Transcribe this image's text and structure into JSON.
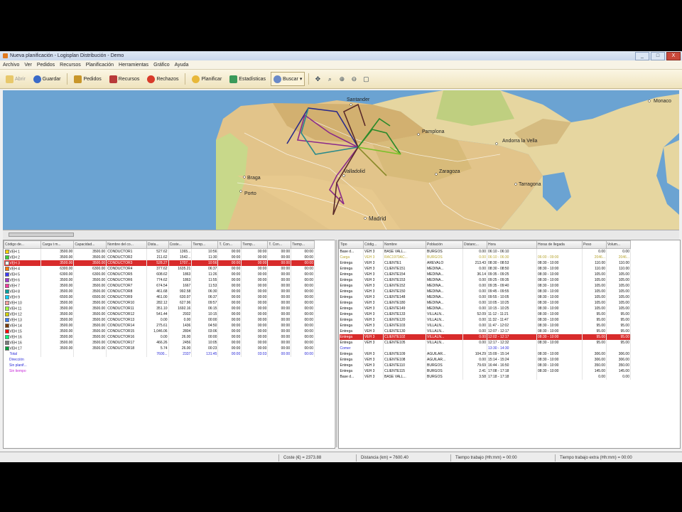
{
  "window": {
    "title": "Nueva planificación - Logisplan Distribución - Demo",
    "min": "_",
    "max": "□",
    "close": "X"
  },
  "menu": [
    "Archivo",
    "Ver",
    "Pedidos",
    "Recursos",
    "Planificación",
    "Herramientas",
    "Gráfico",
    "Ayuda"
  ],
  "toolbar": {
    "abrir": "Abrir",
    "guardar": "Guardar",
    "pedidos": "Pedidos",
    "recursos": "Recursos",
    "rechazos": "Rechazos",
    "planificar": "Planificar",
    "estadisticas": "Estadísticas",
    "buscar": "Buscar"
  },
  "map": {
    "cities": [
      "Santander",
      "Pamplona",
      "Andorra la Vella",
      "Zaragoza",
      "Valladolid",
      "Madrid",
      "Porto",
      "Braga",
      "Monaco",
      "Tarragona"
    ],
    "route_colors": [
      "#2a2a8a",
      "#8a2a8a",
      "#2a8a2a",
      "#8a8a2a",
      "#2a8a8a",
      "#5a2a2a",
      "#7ac02a"
    ]
  },
  "left_table": {
    "headers": [
      "Código de...",
      "Carga t m...",
      "Capacidad...",
      "Nombre del co...",
      "Dista...",
      "Coste...",
      "Tiemp...",
      "T. Con...",
      "Tiemp...",
      "T. Con...",
      "Tiemp..."
    ],
    "rows": [
      {
        "code": "VEH 1",
        "color": "#ffd000",
        "c": [
          "3500.00",
          "3500.00",
          "CONDUCTOR1",
          "527.62",
          "1365...",
          "10:56",
          "00:00",
          "00:00",
          "00:00",
          "00:00"
        ]
      },
      {
        "code": "VEH 2",
        "color": "#3ad03a",
        "c": [
          "3500.00",
          "3500.00",
          "CONDUCTOR2",
          "211.62",
          "1542...",
          "11:30",
          "00:00",
          "00:00",
          "00:00",
          "00:00"
        ]
      },
      {
        "code": "VEH 3",
        "color": "#ffffff",
        "c": [
          "3500.00",
          "3500.00",
          "CONDUCTOR3",
          "528.27",
          "1707...",
          "10:56",
          "00:00",
          "00:00",
          "00:00",
          "00:00"
        ],
        "selected": true
      },
      {
        "code": "VEH 4",
        "color": "#ff7a00",
        "c": [
          "6300.00",
          "6300.00",
          "CONDUCTOR4",
          "377.62",
          "1635.21",
          "06:37",
          "00:00",
          "00:00",
          "00:00",
          "00:00"
        ]
      },
      {
        "code": "VEH 5",
        "color": "#3a3aff",
        "c": [
          "6300.00",
          "6300.00",
          "CONDUCTOR5",
          "608.62",
          "1863",
          "11:26",
          "00:00",
          "00:00",
          "00:00",
          "00:00"
        ]
      },
      {
        "code": "VEH 6",
        "color": "#a03ad0",
        "c": [
          "3500.00",
          "3500.00",
          "CONDUCTOR6",
          "774.62",
          "1863",
          "11:55",
          "00:00",
          "00:00",
          "00:00",
          "00:00"
        ]
      },
      {
        "code": "VEH 7",
        "color": "#ff3aa0",
        "c": [
          "3500.00",
          "3500.00",
          "CONDUCTOR7",
          "674.54",
          "1667",
          "11:53",
          "00:00",
          "00:00",
          "00:00",
          "00:00"
        ]
      },
      {
        "code": "VEH 8",
        "color": "#00a0a0",
        "c": [
          "3500.00",
          "3500.00",
          "CONDUCTOR8",
          "461.68",
          "992.58",
          "06:30",
          "00:00",
          "00:00",
          "00:00",
          "00:00"
        ]
      },
      {
        "code": "VEH 9",
        "color": "#00d0ff",
        "c": [
          "6500.00",
          "6500.00",
          "CONDUCTOR9",
          "461.00",
          "630.97",
          "06:37",
          "00:00",
          "00:00",
          "00:00",
          "00:00"
        ]
      },
      {
        "code": "VEH 10",
        "color": "#ffa0a0",
        "c": [
          "3500.00",
          "3500.00",
          "CONDUCTOR10",
          "282.12",
          "627.96",
          "09:57",
          "00:00",
          "00:00",
          "00:00",
          "00:00"
        ]
      },
      {
        "code": "VEH 11",
        "color": "#a0ff3a",
        "c": [
          "3500.00",
          "3500.00",
          "CONDUCTOR11",
          "351.10",
          "1692.16",
          "06:15",
          "00:00",
          "00:00",
          "00:00",
          "00:00"
        ]
      },
      {
        "code": "VEH 12",
        "color": "#d0d000",
        "c": [
          "3500.00",
          "3500.00",
          "CONDUCTOR12",
          "541.44",
          "2932",
          "10:15",
          "00:00",
          "00:00",
          "00:00",
          "00:00"
        ]
      },
      {
        "code": "VEH 13",
        "color": "#3a7aff",
        "c": [
          "3500.00",
          "3500.00",
          "CONDUCTOR13",
          "0.00",
          "0.00",
          "00:00",
          "00:00",
          "00:00",
          "00:00",
          "00:00"
        ]
      },
      {
        "code": "VEH 14",
        "color": "#7a3a00",
        "c": [
          "3500.00",
          "3500.00",
          "CONDUCTOR14",
          "275.61",
          "1436",
          "04:50",
          "00:00",
          "00:00",
          "00:00",
          "00:00"
        ]
      },
      {
        "code": "VEH 15",
        "color": "#ff0000",
        "c": [
          "3500.00",
          "3500.00",
          "CONDUCTOR15",
          "1,046.06",
          "2804",
          "03:06",
          "00:00",
          "00:00",
          "00:00",
          "00:00"
        ]
      },
      {
        "code": "VEH 16",
        "color": "#00ff7a",
        "c": [
          "3500.00",
          "3500.00",
          "CONDUCTOR16",
          "0.00",
          "26.00",
          "00:00",
          "00:00",
          "00:00",
          "00:00",
          "00:00"
        ]
      },
      {
        "code": "VEH 16",
        "color": "#7a7a7a",
        "c": [
          "3500.00",
          "3500.00",
          "CONDUCTOR17",
          "466.26",
          "2456",
          "10:05",
          "00:00",
          "00:00",
          "00:00",
          "00:00"
        ]
      },
      {
        "code": "VEH 17",
        "color": "#00a03a",
        "c": [
          "3500.00",
          "3500.00",
          "CONDUCTOR18",
          "5.74",
          "26.00",
          "00:23",
          "00:00",
          "00:00",
          "00:00",
          "00:00"
        ]
      }
    ],
    "total": {
      "label": "Total",
      "c": [
        "",
        "",
        "",
        "7600...",
        "2337",
        "131:45",
        "00:00",
        "03:03",
        "00:00",
        "00:00"
      ]
    },
    "summary": [
      "Dirección",
      "Sin planif...",
      "Sin tiempo"
    ]
  },
  "right_table": {
    "headers": [
      "Tipo",
      "Códig...",
      "Nombre",
      "Población",
      "Distanc...",
      "Hora",
      "Horas de llegada",
      "Peso",
      "Volum..."
    ],
    "rows": [
      {
        "c": [
          "Base d...",
          "VEH 3",
          "BASE VALL...",
          "BURGOS",
          "0.00",
          "06:10 - 06:10",
          "",
          "0.00",
          "0.00"
        ]
      },
      {
        "c": [
          "Carga",
          "VEH 3",
          "RAC1970AC...",
          "BURGOS",
          "0.00",
          "06:10 - 06:30",
          "06:00 - 09:00",
          "2046...",
          "2046..."
        ],
        "type": "carga"
      },
      {
        "c": [
          "Entrega",
          "VEH 3",
          "CLIENTE1",
          "AREVALO",
          "213.43",
          "08:30 - 08:53",
          "08:30 - 10:00",
          "110.00",
          "110.00"
        ]
      },
      {
        "c": [
          "Entrega",
          "VEH 3",
          "CLIENTE151",
          "MEDINA...",
          "0.00",
          "08:30 - 08:50",
          "08:30 - 10:00",
          "110.00",
          "110.00"
        ]
      },
      {
        "c": [
          "Entrega",
          "VEH 3",
          "CLIENTE154",
          "MEDINA...",
          "36.14",
          "09:35 - 09:25",
          "08:30 - 10:00",
          "105.00",
          "105.00"
        ]
      },
      {
        "c": [
          "Entrega",
          "VEH 3",
          "CLIENTE153",
          "MEDINA...",
          "0.00",
          "09:25 - 09:35",
          "08:30 - 10:00",
          "105.00",
          "105.00"
        ]
      },
      {
        "c": [
          "Entrega",
          "VEH 3",
          "CLIENTE152",
          "MEDINA...",
          "0.00",
          "09:35 - 09:40",
          "08:30 - 10:00",
          "105.00",
          "105.00"
        ]
      },
      {
        "c": [
          "Entrega",
          "VEH 3",
          "CLIENTE150",
          "MEDINA...",
          "0.00",
          "09:45 - 09:55",
          "08:30 - 10:00",
          "105.00",
          "105.00"
        ]
      },
      {
        "c": [
          "Entrega",
          "VEH 3",
          "CLIENTE148",
          "MEDINA...",
          "0.00",
          "09:55 - 10:05",
          "08:30 - 10:00",
          "105.00",
          "105.00"
        ]
      },
      {
        "c": [
          "Entrega",
          "VEH 3",
          "CLIENTE180",
          "MEDINA...",
          "0.00",
          "10:05 - 10:25",
          "08:30 - 10:00",
          "105.00",
          "105.00"
        ]
      },
      {
        "c": [
          "Entrega",
          "VEH 3",
          "CLIENTE149",
          "MEDINA...",
          "0.00",
          "10:15 - 10:25",
          "08:30 - 10:00",
          "105.00",
          "105.00"
        ]
      },
      {
        "c": [
          "Entrega",
          "VEH 3",
          "CLIENTE133",
          "VILLALN...",
          "52.09",
          "11:12 - 11:21",
          "08:30 - 10:00",
          "95.00",
          "95.00"
        ]
      },
      {
        "c": [
          "Entrega",
          "VEH 3",
          "CLIENTE120",
          "VILLALN...",
          "0.00",
          "11:32 - 11:47",
          "08:30 - 10:00",
          "95.00",
          "95.00"
        ]
      },
      {
        "c": [
          "Entrega",
          "VEH 3",
          "CLIENTE103",
          "VILLALN...",
          "0.00",
          "11:47 - 12:02",
          "08:30 - 10:00",
          "95.00",
          "95.00"
        ]
      },
      {
        "c": [
          "Entrega",
          "VEH 3",
          "CLIENTE130",
          "VILLALN...",
          "0.00",
          "12:07 - 12:17",
          "08:30 - 10:00",
          "95.00",
          "95.00"
        ]
      },
      {
        "c": [
          "Entrega",
          "VEH 3",
          "CLIENTE102",
          "VILLALN...",
          "0.00",
          "12:02 - 12:17",
          "08:30 - 10:00",
          "95.00",
          "95.00"
        ],
        "selected": true
      },
      {
        "c": [
          "Entrega",
          "VEH 3",
          "CLIENTE105",
          "VILLALN...",
          "0.00",
          "12:17 - 12:32",
          "08:30 - 10:00",
          "95.00",
          "95.00"
        ]
      },
      {
        "c": [
          "Comer",
          "",
          "",
          "",
          "",
          "13:30 - 14:30",
          "",
          "",
          ""
        ],
        "type": "blue"
      },
      {
        "c": [
          "Entrega",
          "VEH 3",
          "CLIENTE109",
          "AGUILAR...",
          "104.29",
          "15:09 - 15:14",
          "08:30 - 10:00",
          "306.00",
          "306.00"
        ]
      },
      {
        "c": [
          "Entrega",
          "VEH 3",
          "CLIENTE108",
          "AGUILAR...",
          "0.00",
          "15:14 - 15:24",
          "08:30 - 10:00",
          "306.00",
          "306.00"
        ]
      },
      {
        "c": [
          "Entrega",
          "VEH 3",
          "CLIENTE110",
          "BURGOS",
          "79.69",
          "16:44 - 16:50",
          "08:30 - 10:00",
          "350.00",
          "350.00"
        ]
      },
      {
        "c": [
          "Entrega",
          "VEH 3",
          "CLIENTE115",
          "BURGOS",
          "2.41",
          "17:08 - 17:18",
          "08:30 - 10:00",
          "145.00",
          "145.00"
        ]
      },
      {
        "c": [
          "Base d...",
          "VEH 3",
          "BASE VALL...",
          "BURGOS",
          "3.58",
          "17:18 - 17:18",
          "",
          "0.00",
          "0.00"
        ]
      }
    ]
  },
  "statusbar": {
    "coste": "Coste (€) = 2373.88",
    "distancia": "Distancia (km) = 7600.40",
    "tiempo": "Tiempo trabajo (Hh:mm) = 00:00",
    "tiempo_extra": "Tiempo trabajo extra (Hh:mm) = 00:00"
  }
}
